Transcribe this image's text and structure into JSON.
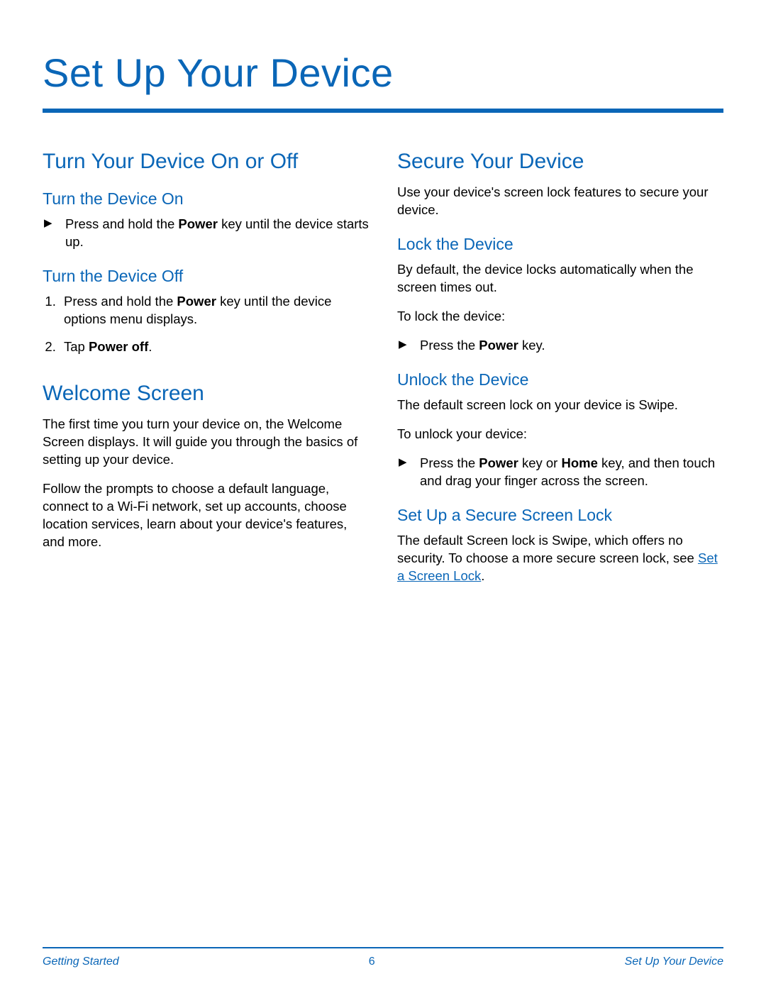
{
  "page": {
    "title": "Set Up Your Device",
    "footer": {
      "left": "Getting Started",
      "center": "6",
      "right": "Set Up Your Device"
    }
  },
  "left": {
    "s1": {
      "title": "Turn Your Device On or Off",
      "sub1": {
        "title": "Turn the Device On",
        "b1_pre": "Press and hold the ",
        "b1_bold": "Power",
        "b1_post": " key until the device starts up."
      },
      "sub2": {
        "title": "Turn the Device Off",
        "n1_pre": "Press and hold the ",
        "n1_bold": "Power",
        "n1_post": " key until the  device options menu displays.",
        "n2_pre": "Tap ",
        "n2_bold": "Power off",
        "n2_post": "."
      }
    },
    "s2": {
      "title": "Welcome Screen",
      "p1": "The first time you turn your device on, the Welcome Screen displays. It will guide you through the basics of setting up your device.",
      "p2": "Follow the prompts to choose a default language, connect to a Wi-Fi network, set up accounts, choose location services, learn about your device's features, and more."
    }
  },
  "right": {
    "s1": {
      "title": "Secure Your Device",
      "p1": "Use your device's screen lock features to secure your device.",
      "sub1": {
        "title": "Lock the Device",
        "p1": "By default, the device locks automatically when the screen times out.",
        "p2": "To lock the device:",
        "b1_pre": "Press the ",
        "b1_bold": "Power",
        "b1_post": " key."
      },
      "sub2": {
        "title": "Unlock the Device",
        "p1": "The default screen lock on your device is Swipe.",
        "p2": "To unlock your device:",
        "b1_pre": "Press the ",
        "b1_bold1": "Power",
        "b1_mid": " key or ",
        "b1_bold2": "Home",
        "b1_post": " key, and then touch and drag your finger across the screen."
      },
      "sub3": {
        "title": "Set Up a Secure Screen Lock",
        "p1_pre": "The default Screen lock is Swipe, which offers no security. To choose a more secure screen lock, see ",
        "p1_link": "Set a Screen Lock",
        "p1_post": "."
      }
    }
  }
}
